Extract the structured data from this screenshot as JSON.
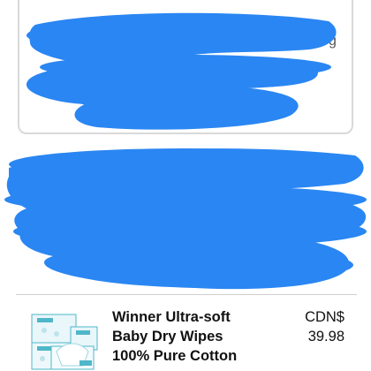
{
  "cart_item": {
    "title_lines": [
      "Winner Ultra-soft",
      "Baby Dry Wipes",
      "100% Pure Cotton"
    ],
    "currency": "CDN$",
    "price": "39.98",
    "thumbnail": "baby-dry-wipes-product-image"
  },
  "colors": {
    "redaction": "#2a86f2",
    "border": "#d9d9d9",
    "text": "#111111",
    "divider": "#cfcfcf",
    "package_accent": "#4fb7c9"
  }
}
